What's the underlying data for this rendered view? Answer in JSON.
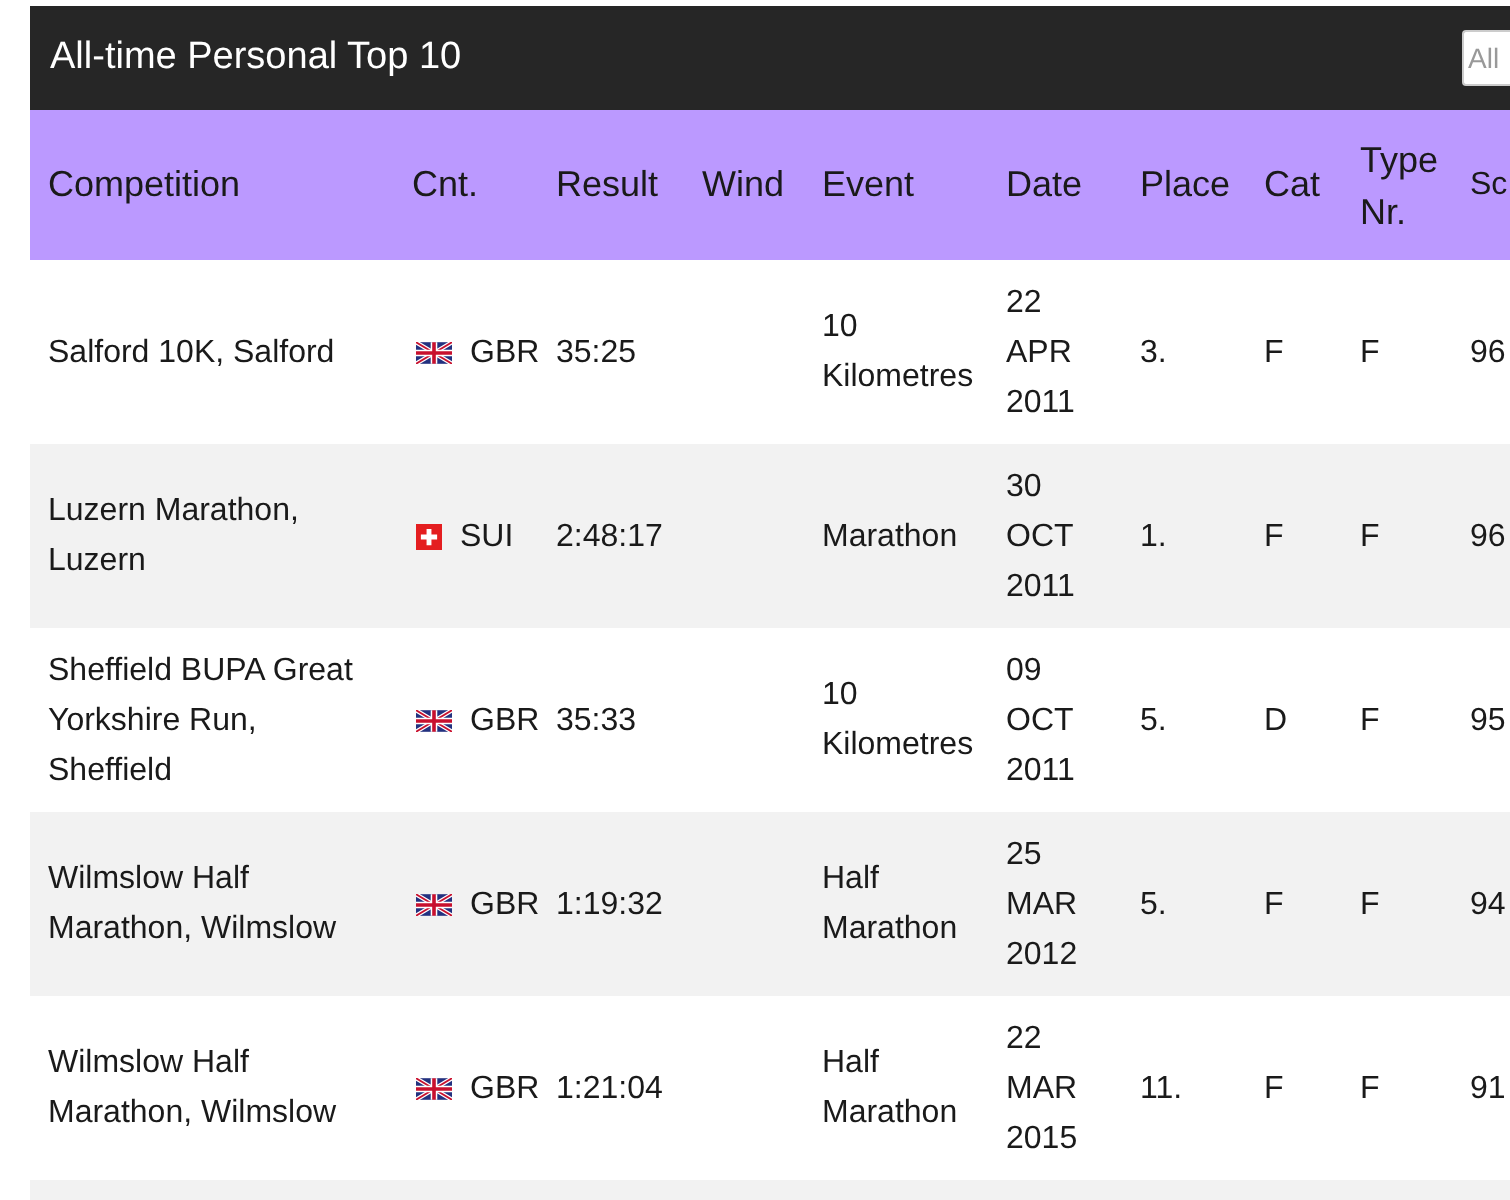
{
  "panel": {
    "title": "All-time Personal Top 10",
    "filter": {
      "placeholder": "All"
    }
  },
  "table": {
    "columns": [
      "Competition",
      "Cnt.",
      "Result",
      "Wind",
      "Event",
      "Date",
      "Place",
      "Cat",
      "Type Nr.",
      "Sc"
    ],
    "rows": [
      {
        "competition": "Salford 10K, Salford",
        "kind": "gbr",
        "country": "GBR",
        "result": "35:25",
        "event": "10 Kilometres",
        "date": "22 APR 2011",
        "place": "3.",
        "cat": "F",
        "type_nr": "F",
        "column_10": "96"
      },
      {
        "competition": "Luzern Marathon, Luzern",
        "kind": "sui",
        "country": "SUI",
        "result": "2:48:17",
        "event": "Marathon",
        "date": "30 OCT 2011",
        "place": "1.",
        "cat": "F",
        "type_nr": "F",
        "column_10": "96"
      },
      {
        "competition": "Sheffield BUPA Great Yorkshire Run, Sheffield",
        "kind": "gbr",
        "country": "GBR",
        "result": "35:33",
        "event": "10 Kilometres",
        "date": "09 OCT 2011",
        "place": "5.",
        "cat": "D",
        "type_nr": "F",
        "column_10": "95"
      },
      {
        "competition": "Wilmslow Half Marathon, Wilmslow",
        "kind": "gbr",
        "country": "GBR",
        "result": "1:19:32",
        "event": "Half Marathon",
        "date": "25 MAR 2012",
        "place": "5.",
        "cat": "F",
        "type_nr": "F",
        "column_10": "94"
      },
      {
        "competition": "Wilmslow Half Marathon, Wilmslow",
        "kind": "gbr",
        "country": "GBR",
        "result": "1:21:04",
        "event": "Half Marathon",
        "date": "22 MAR 2015",
        "place": "11.",
        "cat": "F",
        "type_nr": "F",
        "column_10": "91"
      }
    ]
  }
}
